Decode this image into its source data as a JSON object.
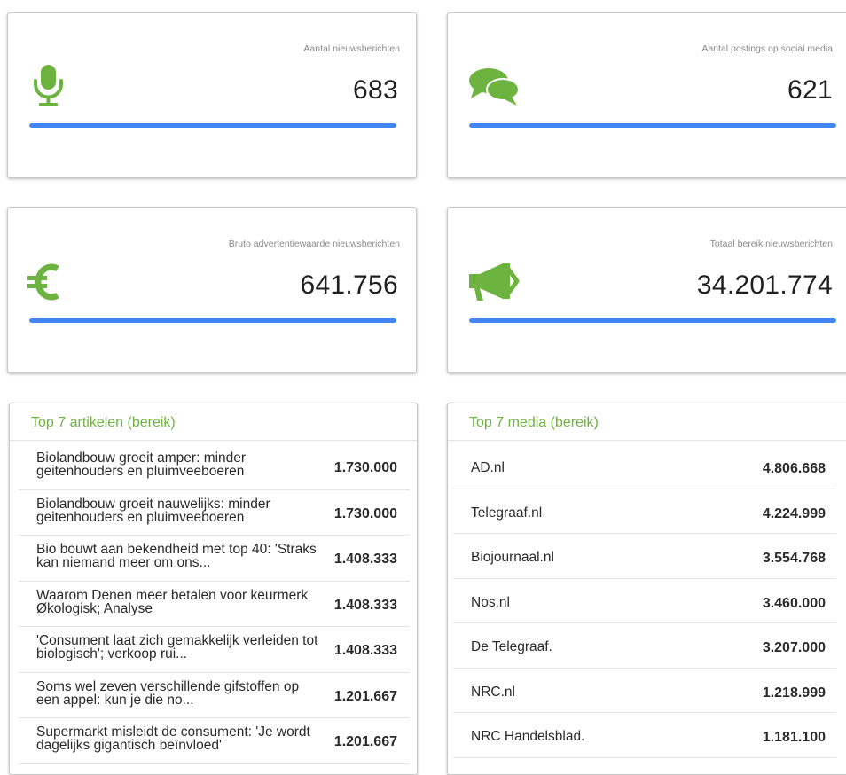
{
  "stats": [
    {
      "label": "Aantal nieuwsberichten",
      "value": "683",
      "icon": "microphone-icon",
      "progress": 1.0
    },
    {
      "label": "Aantal postings op social media",
      "value": "621",
      "icon": "speech-bubbles-icon",
      "progress": 1.0
    },
    {
      "label": "Bruto advertentiewaarde nieuwsberichten",
      "value": "641.756",
      "icon": "euro-icon",
      "progress": 1.0
    },
    {
      "label": "Totaal bereik nieuwsberichten",
      "value": "34.201.774",
      "icon": "megaphone-icon",
      "progress": 1.0
    }
  ],
  "colors": {
    "accent_green": "#6db33f",
    "bar_blue": "#4285f4"
  },
  "articles": {
    "title": "Top 7 artikelen (bereik)",
    "rows": [
      {
        "text": "Biolandbouw groeit amper: minder geitenhouders en pluimveeboeren",
        "value": "1.730.000"
      },
      {
        "text": "Biolandbouw groeit nauwelijks: minder geitenhouders en pluimveeboeren",
        "value": "1.730.000"
      },
      {
        "text": "Bio bouwt aan bekendheid met top 40: 'Straks kan niemand meer om ons...",
        "value": "1.408.333"
      },
      {
        "text": "Waarom Denen meer betalen voor keurmerk Økologisk; Analyse",
        "value": "1.408.333"
      },
      {
        "text": "'Consument laat zich gemakkelijk verleiden tot biologisch'; verkoop rui...",
        "value": "1.408.333"
      },
      {
        "text": "Soms wel zeven verschillende gifstoffen op een appel: kun je die no...",
        "value": "1.201.667"
      },
      {
        "text": "Supermarkt misleidt de consument: 'Je wordt dagelijks gigantisch beïnvloed'",
        "value": "1.201.667"
      }
    ]
  },
  "media": {
    "title": "Top 7 media (bereik)",
    "rows": [
      {
        "text": "AD.nl",
        "value": "4.806.668"
      },
      {
        "text": "Telegraaf.nl",
        "value": "4.224.999"
      },
      {
        "text": "Biojournaal.nl",
        "value": "3.554.768"
      },
      {
        "text": "Nos.nl",
        "value": "3.460.000"
      },
      {
        "text": "De Telegraaf.",
        "value": "3.207.000"
      },
      {
        "text": "NRC.nl",
        "value": "1.218.999"
      },
      {
        "text": "NRC Handelsblad.",
        "value": "1.181.100"
      }
    ]
  }
}
